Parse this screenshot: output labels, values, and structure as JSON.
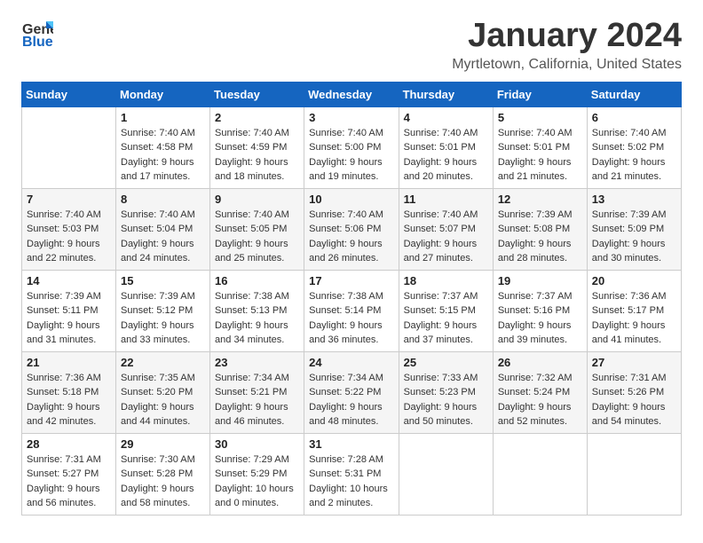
{
  "logo": {
    "line1": "General",
    "line2": "Blue"
  },
  "title": "January 2024",
  "subtitle": "Myrtletown, California, United States",
  "days_of_week": [
    "Sunday",
    "Monday",
    "Tuesday",
    "Wednesday",
    "Thursday",
    "Friday",
    "Saturday"
  ],
  "weeks": [
    [
      {
        "day": "",
        "info": ""
      },
      {
        "day": "1",
        "info": "Sunrise: 7:40 AM\nSunset: 4:58 PM\nDaylight: 9 hours\nand 17 minutes."
      },
      {
        "day": "2",
        "info": "Sunrise: 7:40 AM\nSunset: 4:59 PM\nDaylight: 9 hours\nand 18 minutes."
      },
      {
        "day": "3",
        "info": "Sunrise: 7:40 AM\nSunset: 5:00 PM\nDaylight: 9 hours\nand 19 minutes."
      },
      {
        "day": "4",
        "info": "Sunrise: 7:40 AM\nSunset: 5:01 PM\nDaylight: 9 hours\nand 20 minutes."
      },
      {
        "day": "5",
        "info": "Sunrise: 7:40 AM\nSunset: 5:01 PM\nDaylight: 9 hours\nand 21 minutes."
      },
      {
        "day": "6",
        "info": "Sunrise: 7:40 AM\nSunset: 5:02 PM\nDaylight: 9 hours\nand 21 minutes."
      }
    ],
    [
      {
        "day": "7",
        "info": "Sunrise: 7:40 AM\nSunset: 5:03 PM\nDaylight: 9 hours\nand 22 minutes."
      },
      {
        "day": "8",
        "info": "Sunrise: 7:40 AM\nSunset: 5:04 PM\nDaylight: 9 hours\nand 24 minutes."
      },
      {
        "day": "9",
        "info": "Sunrise: 7:40 AM\nSunset: 5:05 PM\nDaylight: 9 hours\nand 25 minutes."
      },
      {
        "day": "10",
        "info": "Sunrise: 7:40 AM\nSunset: 5:06 PM\nDaylight: 9 hours\nand 26 minutes."
      },
      {
        "day": "11",
        "info": "Sunrise: 7:40 AM\nSunset: 5:07 PM\nDaylight: 9 hours\nand 27 minutes."
      },
      {
        "day": "12",
        "info": "Sunrise: 7:39 AM\nSunset: 5:08 PM\nDaylight: 9 hours\nand 28 minutes."
      },
      {
        "day": "13",
        "info": "Sunrise: 7:39 AM\nSunset: 5:09 PM\nDaylight: 9 hours\nand 30 minutes."
      }
    ],
    [
      {
        "day": "14",
        "info": "Sunrise: 7:39 AM\nSunset: 5:11 PM\nDaylight: 9 hours\nand 31 minutes."
      },
      {
        "day": "15",
        "info": "Sunrise: 7:39 AM\nSunset: 5:12 PM\nDaylight: 9 hours\nand 33 minutes."
      },
      {
        "day": "16",
        "info": "Sunrise: 7:38 AM\nSunset: 5:13 PM\nDaylight: 9 hours\nand 34 minutes."
      },
      {
        "day": "17",
        "info": "Sunrise: 7:38 AM\nSunset: 5:14 PM\nDaylight: 9 hours\nand 36 minutes."
      },
      {
        "day": "18",
        "info": "Sunrise: 7:37 AM\nSunset: 5:15 PM\nDaylight: 9 hours\nand 37 minutes."
      },
      {
        "day": "19",
        "info": "Sunrise: 7:37 AM\nSunset: 5:16 PM\nDaylight: 9 hours\nand 39 minutes."
      },
      {
        "day": "20",
        "info": "Sunrise: 7:36 AM\nSunset: 5:17 PM\nDaylight: 9 hours\nand 41 minutes."
      }
    ],
    [
      {
        "day": "21",
        "info": "Sunrise: 7:36 AM\nSunset: 5:18 PM\nDaylight: 9 hours\nand 42 minutes."
      },
      {
        "day": "22",
        "info": "Sunrise: 7:35 AM\nSunset: 5:20 PM\nDaylight: 9 hours\nand 44 minutes."
      },
      {
        "day": "23",
        "info": "Sunrise: 7:34 AM\nSunset: 5:21 PM\nDaylight: 9 hours\nand 46 minutes."
      },
      {
        "day": "24",
        "info": "Sunrise: 7:34 AM\nSunset: 5:22 PM\nDaylight: 9 hours\nand 48 minutes."
      },
      {
        "day": "25",
        "info": "Sunrise: 7:33 AM\nSunset: 5:23 PM\nDaylight: 9 hours\nand 50 minutes."
      },
      {
        "day": "26",
        "info": "Sunrise: 7:32 AM\nSunset: 5:24 PM\nDaylight: 9 hours\nand 52 minutes."
      },
      {
        "day": "27",
        "info": "Sunrise: 7:31 AM\nSunset: 5:26 PM\nDaylight: 9 hours\nand 54 minutes."
      }
    ],
    [
      {
        "day": "28",
        "info": "Sunrise: 7:31 AM\nSunset: 5:27 PM\nDaylight: 9 hours\nand 56 minutes."
      },
      {
        "day": "29",
        "info": "Sunrise: 7:30 AM\nSunset: 5:28 PM\nDaylight: 9 hours\nand 58 minutes."
      },
      {
        "day": "30",
        "info": "Sunrise: 7:29 AM\nSunset: 5:29 PM\nDaylight: 10 hours\nand 0 minutes."
      },
      {
        "day": "31",
        "info": "Sunrise: 7:28 AM\nSunset: 5:31 PM\nDaylight: 10 hours\nand 2 minutes."
      },
      {
        "day": "",
        "info": ""
      },
      {
        "day": "",
        "info": ""
      },
      {
        "day": "",
        "info": ""
      }
    ]
  ]
}
